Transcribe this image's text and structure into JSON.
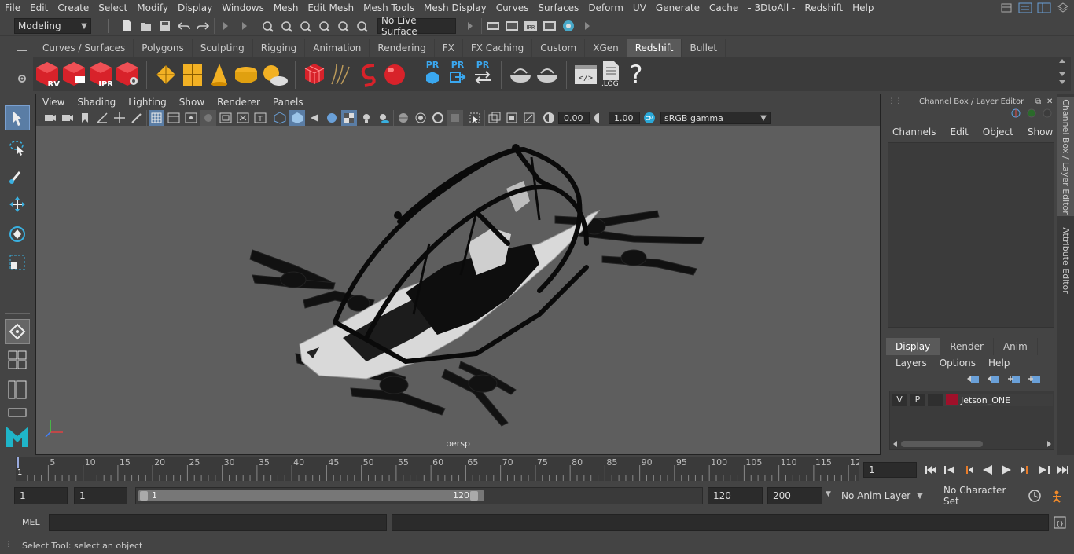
{
  "menubar": {
    "items": [
      "File",
      "Edit",
      "Create",
      "Select",
      "Modify",
      "Display",
      "Windows",
      "Mesh",
      "Edit Mesh",
      "Mesh Tools",
      "Mesh Display",
      "Curves",
      "Surfaces",
      "Deform",
      "UV",
      "Generate",
      "Cache",
      "- 3DtoAll -",
      "Redshift",
      "Help"
    ]
  },
  "statusline": {
    "mode": "Modeling",
    "live_surface": "No Live Surface"
  },
  "shelf": {
    "tabs": [
      "Curves / Surfaces",
      "Polygons",
      "Sculpting",
      "Rigging",
      "Animation",
      "Rendering",
      "FX",
      "FX Caching",
      "Custom",
      "XGen",
      "Redshift",
      "Bullet"
    ],
    "active_tab": "Redshift",
    "rs_labels": [
      "RV",
      "IPR"
    ],
    "pr_labels": [
      "PR",
      "PR",
      "PR"
    ],
    "log_label": ".LOG",
    "help_glyph": "?"
  },
  "viewport": {
    "menu": [
      "View",
      "Shading",
      "Lighting",
      "Show",
      "Renderer",
      "Panels"
    ],
    "exposure": "0.00",
    "gamma": "1.00",
    "color_space": "sRGB gamma",
    "camera_label": "persp"
  },
  "channel_box": {
    "title": "Channel Box / Layer Editor",
    "menu": [
      "Channels",
      "Edit",
      "Object",
      "Show"
    ],
    "layer_tabs": [
      "Display",
      "Render",
      "Anim"
    ],
    "active_layer_tab": "Display",
    "layer_menu": [
      "Layers",
      "Options",
      "Help"
    ],
    "layer": {
      "v": "V",
      "p": "P",
      "name": "Jetson_ONE",
      "color": "#a0102a"
    }
  },
  "side_tabs": [
    "Channel Box / Layer Editor",
    "Attribute Editor"
  ],
  "timeline": {
    "ticks": [
      "5",
      "10",
      "15",
      "20",
      "25",
      "30",
      "35",
      "40",
      "45",
      "50",
      "55",
      "60",
      "65",
      "70",
      "75",
      "80",
      "85",
      "90",
      "95",
      "100",
      "105",
      "110",
      "115",
      "12"
    ],
    "start_marker": "1",
    "current_frame": "1"
  },
  "range": {
    "start": "1",
    "playback_start": "1",
    "slider_start": "1",
    "slider_end": "120",
    "playback_end": "120",
    "end": "200",
    "anim_layer": "No Anim Layer",
    "character_set": "No Character Set"
  },
  "cmdline": {
    "label": "MEL"
  },
  "helpline": {
    "text": "Select Tool: select an object"
  }
}
